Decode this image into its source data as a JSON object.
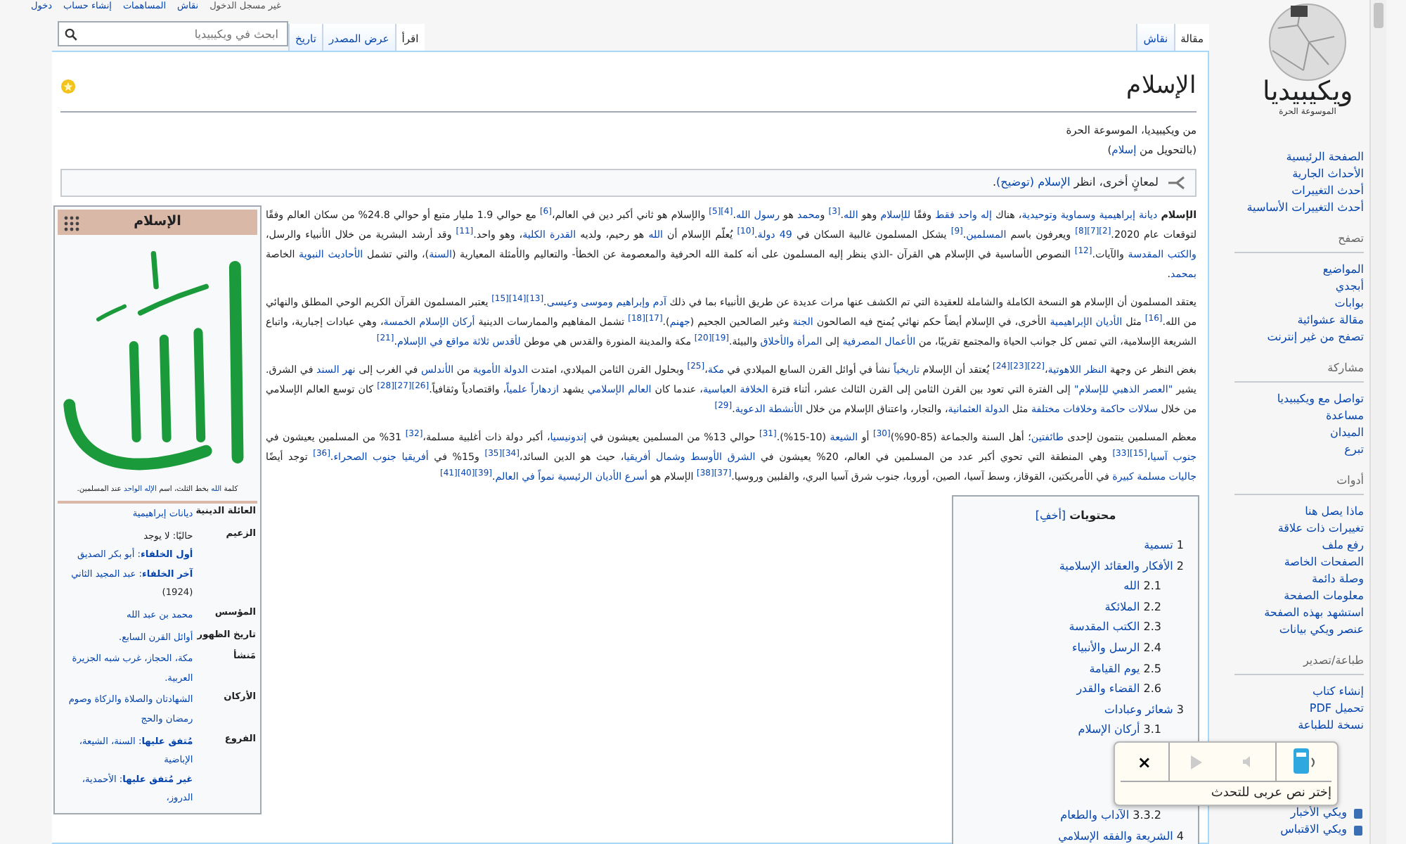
{
  "personal_links": [
    "غير مسجل الدخول",
    "نقاش",
    "المساهمات",
    "إنشاء حساب",
    "دخول"
  ],
  "logo": {
    "wordmark": "ويكيبيديا",
    "tagline": "الموسوعة الحرة"
  },
  "sidebar": {
    "main_links": [
      "الصفحة الرئيسية",
      "الأحداث الجارية",
      "أحدث التغييرات",
      "أحدث التغييرات الأساسية"
    ],
    "sections": [
      {
        "heading": "تصفح",
        "items": [
          "المواضيع",
          "أبجدي",
          "بوابات",
          "مقالة عشوائية",
          "تصفح من غير إنترنت"
        ]
      },
      {
        "heading": "مشاركة",
        "items": [
          "تواصل مع ويكيبيديا",
          "مساعدة",
          "الميدان",
          "تبرع"
        ]
      },
      {
        "heading": "أدوات",
        "items": [
          "ماذا يصل هنا",
          "تغييرات ذات علاقة",
          "رفع ملف",
          "الصفحات الخاصة",
          "وصلة دائمة",
          "معلومات الصفحة",
          "استشهد بهذه الصفحة",
          "عنصر ويكي بيانات"
        ]
      },
      {
        "heading": "طباعة/تصدير",
        "items": [
          "إنشاء كتاب",
          "تحميل PDF",
          "نسخة للطباعة"
        ]
      },
      {
        "items": [
          "ويكي الأخبار",
          "ويكي الاقتباس"
        ],
        "with_icons": true
      }
    ]
  },
  "tabs_right": [
    {
      "label": "مقالة",
      "selected": true
    },
    {
      "label": "نقاش",
      "selected": false
    }
  ],
  "tabs_left": [
    {
      "label": "اقرأ",
      "selected": true
    },
    {
      "label": "عرض المصدر",
      "selected": false
    },
    {
      "label": "تاريخ",
      "selected": false
    }
  ],
  "search": {
    "placeholder": "ابحث في ويكيبيديا"
  },
  "title": "الإسلام",
  "featured": true,
  "subtitle": "من ويكيبيديا، الموسوعة الحرة",
  "redirect": [
    {
      "kind": "text",
      "text": "(بالتحويل من "
    },
    {
      "kind": "link",
      "text": "إسلام"
    },
    {
      "kind": "text",
      "text": ")"
    }
  ],
  "hatnote": [
    {
      "kind": "text",
      "text": "لمعانٍ أخرى، انظر "
    },
    {
      "kind": "link",
      "text": "الإسلام (توضيح)"
    },
    {
      "kind": "text",
      "text": "."
    }
  ],
  "paragraphs": [
    [
      {
        "kind": "text",
        "text": "**الإسلام** "
      },
      {
        "kind": "link",
        "text": "ديانة إبراهيمية وسماوية وتوحيدية"
      },
      {
        "kind": "text",
        "text": "، هناك "
      },
      {
        "kind": "link",
        "text": "إله واحد فقط"
      },
      {
        "kind": "text",
        "text": " وفقًا "
      },
      {
        "kind": "link",
        "text": "للإسلام"
      },
      {
        "kind": "text",
        "text": " وهو "
      },
      {
        "kind": "link",
        "text": "الله"
      },
      {
        "kind": "text",
        "text": ".$^{[3]}$ و"
      },
      {
        "kind": "link",
        "text": "محمد"
      },
      {
        "kind": "text",
        "text": " هو "
      },
      {
        "kind": "link",
        "text": "رسول الله"
      },
      {
        "kind": "text",
        "text": ".$^{[4][5]}$ والإسلام هو ثاني أكبر دين في العالم،$^{[6]}$ مع حوالي 1.9 مليار متبع أو حوالي 24.8% من سكان العالم وفقًا لتوقعات عام 2020.$^{[2][7][8]}$ ويعرفون باسم "
      },
      {
        "kind": "link",
        "text": "المسلمين"
      },
      {
        "kind": "text",
        "text": ".$^{[9]}$ يشكل المسلمون غالبية السكان في "
      },
      {
        "kind": "link",
        "text": "49 دولة"
      },
      {
        "kind": "text",
        "text": ".$^{[10]}$ يُعلّم الإسلام أن "
      },
      {
        "kind": "link",
        "text": "الله"
      },
      {
        "kind": "text",
        "text": " هو رحيم، ولديه "
      },
      {
        "kind": "link",
        "text": "القدرة الكلية"
      },
      {
        "kind": "text",
        "text": "، وهو واحد.$^{[11]}$ وقد أرشد البشرية من خلال الأنبياء والرسل، "
      },
      {
        "kind": "link",
        "text": "والكتب المقدسة"
      },
      {
        "kind": "text",
        "text": " والآيات.$^{[12]}$ النصوص الأساسية في الإسلام هي القرآن -الذي ينظر إليه المسلمون على أنه كلمة الله الحرفية والمعصومة عن الخطأ- والتعاليم والأمثلة المعيارية ("
      },
      {
        "kind": "link",
        "text": "السنة"
      },
      {
        "kind": "text",
        "text": ")، والتي تشمل "
      },
      {
        "kind": "link",
        "text": "الأحاديث النبوية"
      },
      {
        "kind": "text",
        "text": " الخاصة "
      },
      {
        "kind": "link",
        "text": "بمحمد"
      },
      {
        "kind": "text",
        "text": "."
      }
    ],
    [
      {
        "kind": "text",
        "text": "يعتقد المسلمون أن الإسلام هو النسخة الكاملة والشاملة للعقيدة التي تم الكشف عنها مرات عديدة عن طريق الأنبياء بما في ذلك "
      },
      {
        "kind": "link",
        "text": "آدم وإبراهيم وموسى وعيسى"
      },
      {
        "kind": "text",
        "text": ".$^{[13][14][15]}$ يعتبر المسلمون القرآن الكريم الوحي المطلق والنهائي من الله.$^{[16]}$ مثل "
      },
      {
        "kind": "link",
        "text": "الأديان الإبراهيمية"
      },
      {
        "kind": "text",
        "text": " الأخرى، في الإسلام أيضاً حكم نهائي يُمنح فيه الصالحون "
      },
      {
        "kind": "link",
        "text": "الجنة"
      },
      {
        "kind": "text",
        "text": " وغير الصالحين الجحيم ("
      },
      {
        "kind": "link",
        "text": "جهنم"
      },
      {
        "kind": "text",
        "text": ").$^{[17][18]}$ تشمل المفاهيم والممارسات الدينية "
      },
      {
        "kind": "link",
        "text": "أركان الإسلام الخمسة"
      },
      {
        "kind": "text",
        "text": "، وهي عبادات إجبارية، واتباع الشريعة الإسلامية، التي تمس كل جوانب الحياة والمجتمع تقريبًا، من "
      },
      {
        "kind": "link",
        "text": "الأعمال المصرفية"
      },
      {
        "kind": "text",
        "text": " إلى "
      },
      {
        "kind": "link",
        "text": "المرأة والأخلاق"
      },
      {
        "kind": "text",
        "text": " والبيئة.$^{[19][20]}$ مكة والمدينة المنورة والقدس هي موطن "
      },
      {
        "kind": "link",
        "text": "لأقدس ثلاثة مواقع في الإسلام"
      },
      {
        "kind": "text",
        "text": ".$^{[21]}$"
      }
    ],
    [
      {
        "kind": "text",
        "text": "بغض النظر عن وجهة "
      },
      {
        "kind": "link",
        "text": "النظر اللاهوتية"
      },
      {
        "kind": "text",
        "text": "،$^{[22][23][24]}$ يُعتقد أن الإسلام "
      },
      {
        "kind": "link",
        "text": "تاريخياً"
      },
      {
        "kind": "text",
        "text": " نشأ في أوائل القرن السابع الميلادي في "
      },
      {
        "kind": "link",
        "text": "مكة"
      },
      {
        "kind": "text",
        "text": "،$^{[25]}$ وبحلول القرن الثامن الميلادي، امتدت "
      },
      {
        "kind": "link",
        "text": "الدولة الأموية"
      },
      {
        "kind": "text",
        "text": " من "
      },
      {
        "kind": "link",
        "text": "الأندلس"
      },
      {
        "kind": "text",
        "text": " في الغرب إلى "
      },
      {
        "kind": "link",
        "text": "نهر السند"
      },
      {
        "kind": "text",
        "text": " في الشرق. يشير "
      },
      {
        "kind": "link",
        "text": "\"العصر الذهبي للإسلام\""
      },
      {
        "kind": "text",
        "text": " إلى الفترة التي تعود بين القرن الثامن إلى القرن الثالث عشر، أثناء فترة "
      },
      {
        "kind": "link",
        "text": "الخلافة العباسية"
      },
      {
        "kind": "text",
        "text": "، عندما كان "
      },
      {
        "kind": "link",
        "text": "العالم الإسلامي"
      },
      {
        "kind": "text",
        "text": " يشهد "
      },
      {
        "kind": "link",
        "text": "ازدهاراً علمياً"
      },
      {
        "kind": "text",
        "text": "، واقتصادياً وثقافياً.$^{[26][27][28]}$ كان توسع العالم الإسلامي من خلال "
      },
      {
        "kind": "link",
        "text": "سلالات حاكمة وخلافات مختلفة"
      },
      {
        "kind": "text",
        "text": " مثل "
      },
      {
        "kind": "link",
        "text": "الدولة العثمانية"
      },
      {
        "kind": "text",
        "text": "، والتجار، واعتناق الإسلام من خلال "
      },
      {
        "kind": "link",
        "text": "الأنشطة الدعوية"
      },
      {
        "kind": "text",
        "text": ".$^{[29]}$"
      }
    ],
    [
      {
        "kind": "text",
        "text": "معظم المسلمين ينتمون لإحدى "
      },
      {
        "kind": "link",
        "text": "طائفتين"
      },
      {
        "kind": "text",
        "text": "؛ أهل السنة والجماعة (85-90%)$^{[30]}$ أو "
      },
      {
        "kind": "link",
        "text": "الشيعة"
      },
      {
        "kind": "text",
        "text": " (10-15%).$^{[31]}$ حوالي 13% من المسلمين يعيشون في "
      },
      {
        "kind": "link",
        "text": "إندونيسيا"
      },
      {
        "kind": "text",
        "text": "، أكبر دولة ذات أغلبية مسلمة،$^{[32]}$ 31% من المسلمين يعيشون في "
      },
      {
        "kind": "link",
        "text": "جنوب آسيا"
      },
      {
        "kind": "text",
        "text": "،$^{[15][33]}$ وهي المنطقة التي تحوي أكبر عدد من المسلمين في العالم، 20% يعيشون في "
      },
      {
        "kind": "link",
        "text": "الشرق الأوسط وشمال أفريقيا"
      },
      {
        "kind": "text",
        "text": "، حيث هو الدين السائد،$^{[34][35]}$ و15% في "
      },
      {
        "kind": "link",
        "text": "أفريقيا جنوب الصحراء"
      },
      {
        "kind": "text",
        "text": ".$^{[36]}$ توجد أيضًا "
      },
      {
        "kind": "link",
        "text": "جاليات مسلمة كبيرة"
      },
      {
        "kind": "text",
        "text": " في الأمريكتين، القوقاز، وسط آسيا، الصين، أوروبا، جنوب شرق آسيا البري، والفلبين وروسيا.$^{[37][38]}$ الإسلام هو "
      },
      {
        "kind": "link",
        "text": "أسرع الأديان الرئيسية نمواً في العالم"
      },
      {
        "kind": "text",
        "text": ".$^{[39][40][41]}$"
      }
    ]
  ],
  "infobox": {
    "title": "الإسلام",
    "caption": [
      {
        "kind": "text",
        "text": "كلمة "
      },
      {
        "kind": "link",
        "text": "الله"
      },
      {
        "kind": "text",
        "text": " بخط الثلث، اسم "
      },
      {
        "kind": "link",
        "text": "الإله الواحد"
      },
      {
        "kind": "text",
        "text": " عند المسلمين."
      }
    ],
    "rows": [
      {
        "label": "العائلة الدينية",
        "lines": [
          {
            "text": "ديانات إبراهيمية",
            "link": true
          }
        ]
      },
      {
        "label": "الزعيم",
        "lines": [
          {
            "text": "حاليًا: لا يوجد",
            "link": false
          },
          {
            "text": "**أول الخلفاء**: أبو بكر الصديق",
            "link": true
          },
          {
            "text": "**آخر الخلفاء**: عبد المجيد الثاني",
            "link": true
          },
          {
            "text": "(1924)",
            "link": false
          }
        ]
      },
      {
        "label": "المؤسس",
        "lines": [
          {
            "text": "محمد بن عبد الله",
            "link": true
          }
        ]
      },
      {
        "label": "تاريخ الظهور",
        "lines": [
          {
            "text": "أوائل القرن السابع.",
            "link": true
          }
        ]
      },
      {
        "label": "مَنشأ",
        "lines": [
          {
            "text": "مكة، الحجاز، غرب شبه الجزيرة العربية.",
            "link": true
          }
        ]
      },
      {
        "label": "الأركان",
        "lines": [
          {
            "text": "الشهادتان والصلاة والزكاة وصوم رمضان والحج",
            "link": true
          }
        ]
      },
      {
        "label": "الفروع",
        "lines": [
          {
            "text": "**مُتفق عليها**: السنة، الشيعة، الإباضية",
            "link": true
          },
          {
            "text": "**غير مُتفق عليها**: الأحمدية، الدروز،",
            "link": true
          }
        ]
      }
    ]
  },
  "toc": {
    "title": "محتويات",
    "toggle": "[أخفِ]",
    "items": [
      {
        "number": "1",
        "label": "تسمية"
      },
      {
        "number": "2",
        "label": "الأفكار والعقائد الإسلامية",
        "children": [
          {
            "number": "2.1",
            "label": "الله"
          },
          {
            "number": "2.2",
            "label": "الملائكة"
          },
          {
            "number": "2.3",
            "label": "الكتب المقدسة"
          },
          {
            "number": "2.4",
            "label": "الرسل والأنبياء"
          },
          {
            "number": "2.5",
            "label": "يوم القيامة"
          },
          {
            "number": "2.6",
            "label": "القضاء والقدر"
          }
        ]
      },
      {
        "number": "3",
        "label": "شعائر وعبادات",
        "children": [
          {
            "number": "3.1",
            "label": "أركان الإسلام"
          },
          {
            "number": "3.3.2",
            "label": "الآداب والطعام",
            "after_gap": true
          }
        ]
      },
      {
        "number": "4",
        "label": "الشريعة والفقه الإسلامي"
      }
    ]
  },
  "speech_popup": {
    "prompt": "إختر نص عربى للتحدث",
    "close": "×",
    "play_enabled": false
  }
}
